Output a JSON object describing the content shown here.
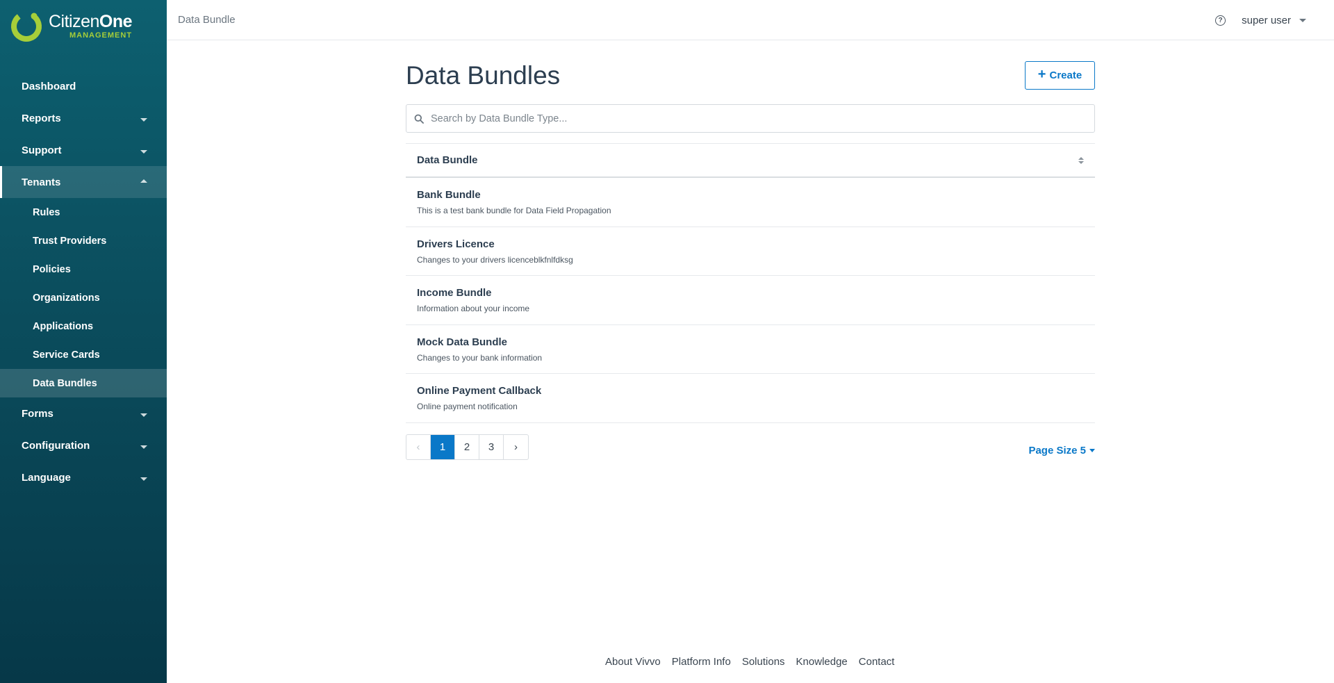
{
  "brand": {
    "name_light": "Citizen",
    "name_bold": "One",
    "subtitle": "MANAGEMENT",
    "accent_color": "#a6ce39",
    "sidebar_color": "#0b4d5d"
  },
  "nav": {
    "items": [
      {
        "label": "Dashboard"
      },
      {
        "label": "Reports"
      },
      {
        "label": "Support"
      },
      {
        "label": "Tenants"
      },
      {
        "label": "Forms"
      },
      {
        "label": "Configuration"
      },
      {
        "label": "Language"
      }
    ],
    "tenants_sub": [
      {
        "label": "Rules"
      },
      {
        "label": "Trust Providers"
      },
      {
        "label": "Policies"
      },
      {
        "label": "Organizations"
      },
      {
        "label": "Applications"
      },
      {
        "label": "Service Cards"
      },
      {
        "label": "Data Bundles"
      }
    ]
  },
  "header": {
    "breadcrumb": "Data Bundle",
    "help_icon": "question-circle-icon",
    "help_glyph": "?",
    "user_name": "super user"
  },
  "main": {
    "title": "Data Bundles",
    "create_label": "Create",
    "create_plus": "+",
    "search_placeholder": "Search by Data Bundle Type...",
    "column_header": "Data Bundle",
    "rows": [
      {
        "title": "Bank Bundle",
        "desc": "This is a test bank bundle for Data Field Propagation"
      },
      {
        "title": "Drivers Licence",
        "desc": "Changes to your drivers licenceblkfnlfdksg"
      },
      {
        "title": "Income Bundle",
        "desc": "Information about your income"
      },
      {
        "title": "Mock Data Bundle",
        "desc": "Changes to your bank information"
      },
      {
        "title": "Online Payment Callback",
        "desc": "Online payment notification"
      }
    ],
    "pagination": {
      "prev": "‹",
      "pages": [
        "1",
        "2",
        "3"
      ],
      "next": "›",
      "current": "1"
    },
    "page_size_label": "Page Size 5",
    "primary_color": "#0a78c8"
  },
  "footer": {
    "links": [
      "About Vivvo",
      "Platform Info",
      "Solutions",
      "Knowledge",
      "Contact"
    ]
  }
}
